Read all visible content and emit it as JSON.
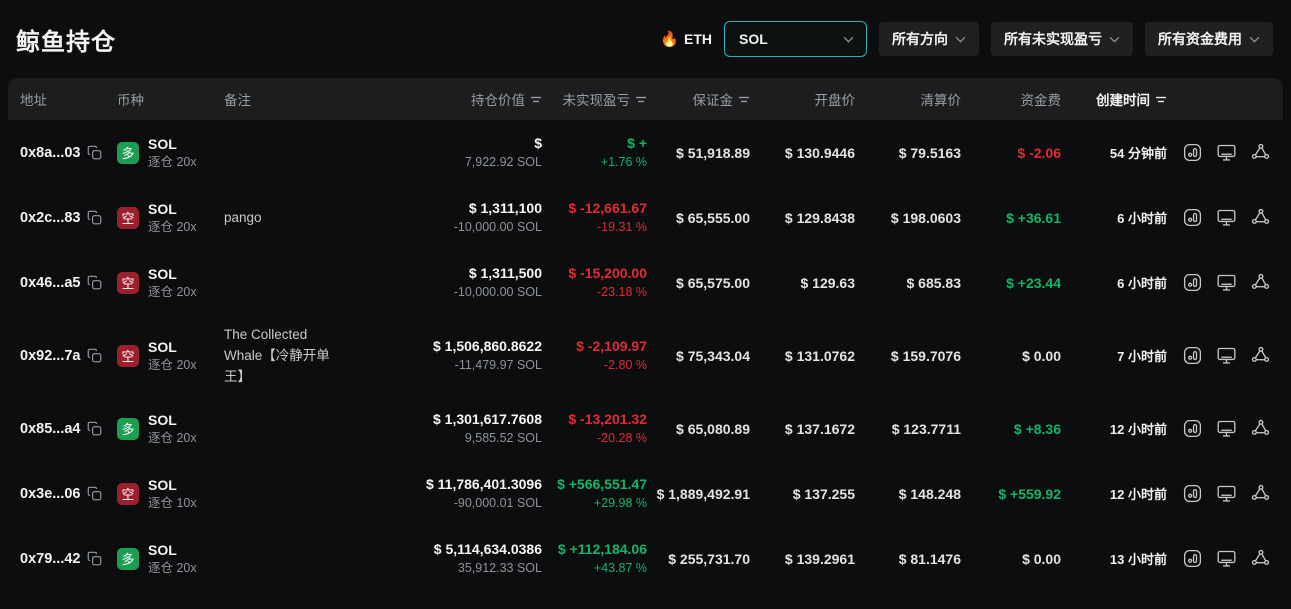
{
  "page": {
    "title": "鲸鱼持仓"
  },
  "filters": {
    "fire_icon": "🔥",
    "hot_coin_label": "ETH",
    "coin_select": {
      "value": "SOL"
    },
    "direction_dropdown": "所有方向",
    "pnl_dropdown": "所有未实现盈亏",
    "funding_dropdown": "所有资金费用"
  },
  "colors": {
    "green": "#0fb768",
    "red": "#e12b36",
    "accent_teal": "#2fb2b5",
    "badge_green": "#1e9e53",
    "badge_red": "#9c1f2d"
  },
  "table": {
    "columns": [
      {
        "label": "地址"
      },
      {
        "label": "币种"
      },
      {
        "label": "备注"
      },
      {
        "label": "持仓价值"
      },
      {
        "label": "未实现盈亏"
      },
      {
        "label": "保证金"
      },
      {
        "label": "开盘价"
      },
      {
        "label": "清算价"
      },
      {
        "label": "资金费"
      },
      {
        "label": "创建时间"
      }
    ],
    "rows": [
      {
        "address": "0x8a...03",
        "side": "多",
        "side_dir": "long",
        "coin": "SOL",
        "mode": "逐仓 20x",
        "note": "",
        "value_usd": "$",
        "value_amt": "7,922.92 SOL",
        "pnl_usd": "$ +",
        "pnl_pct": "+1.76 %",
        "pnl_dir": "up",
        "margin": "$ 51,918.89",
        "open_price": "$ 130.9446",
        "liq_price": "$ 79.5163",
        "funding": "$ -2.06",
        "funding_dir": "down",
        "created": "54 分钟前"
      },
      {
        "address": "0x2c...83",
        "side": "空",
        "side_dir": "short",
        "coin": "SOL",
        "mode": "逐仓 20x",
        "note": "pango",
        "value_usd": "$ 1,311,100",
        "value_amt": "-10,000.00 SOL",
        "pnl_usd": "$ -12,661.67",
        "pnl_pct": "-19.31 %",
        "pnl_dir": "down",
        "margin": "$ 65,555.00",
        "open_price": "$ 129.8438",
        "liq_price": "$ 198.0603",
        "funding": "$ +36.61",
        "funding_dir": "up",
        "created": "6 小时前"
      },
      {
        "address": "0x46...a5",
        "side": "空",
        "side_dir": "short",
        "coin": "SOL",
        "mode": "逐仓 20x",
        "note": "",
        "value_usd": "$ 1,311,500",
        "value_amt": "-10,000.00 SOL",
        "pnl_usd": "$ -15,200.00",
        "pnl_pct": "-23.18 %",
        "pnl_dir": "down",
        "margin": "$ 65,575.00",
        "open_price": "$ 129.63",
        "liq_price": "$ 685.83",
        "funding": "$ +23.44",
        "funding_dir": "up",
        "created": "6 小时前"
      },
      {
        "address": "0x92...7a",
        "side": "空",
        "side_dir": "short",
        "coin": "SOL",
        "mode": "逐仓 20x",
        "note": "The Collected Whale【冷静开单王】",
        "value_usd": "$ 1,506,860.8622",
        "value_amt": "-11,479.97 SOL",
        "pnl_usd": "$ -2,109.97",
        "pnl_pct": "-2.80 %",
        "pnl_dir": "down",
        "margin": "$ 75,343.04",
        "open_price": "$ 131.0762",
        "liq_price": "$ 159.7076",
        "funding": "$ 0.00",
        "funding_dir": "flat",
        "created": "7 小时前"
      },
      {
        "address": "0x85...a4",
        "side": "多",
        "side_dir": "long",
        "coin": "SOL",
        "mode": "逐仓 20x",
        "note": "",
        "value_usd": "$ 1,301,617.7608",
        "value_amt": "9,585.52 SOL",
        "pnl_usd": "$ -13,201.32",
        "pnl_pct": "-20.28 %",
        "pnl_dir": "down",
        "margin": "$ 65,080.89",
        "open_price": "$ 137.1672",
        "liq_price": "$ 123.7711",
        "funding": "$ +8.36",
        "funding_dir": "up",
        "created": "12 小时前"
      },
      {
        "address": "0x3e...06",
        "side": "空",
        "side_dir": "short",
        "coin": "SOL",
        "mode": "逐仓 10x",
        "note": "",
        "value_usd": "$ 11,786,401.3096",
        "value_amt": "-90,000.01 SOL",
        "pnl_usd": "$ +566,551.47",
        "pnl_pct": "+29.98 %",
        "pnl_dir": "up",
        "margin": "$ 1,889,492.91",
        "open_price": "$ 137.255",
        "liq_price": "$ 148.248",
        "funding": "$ +559.92",
        "funding_dir": "up",
        "created": "12 小时前"
      },
      {
        "address": "0x79...42",
        "side": "多",
        "side_dir": "long",
        "coin": "SOL",
        "mode": "逐仓 20x",
        "note": "",
        "value_usd": "$ 5,114,634.0386",
        "value_amt": "35,912.33 SOL",
        "pnl_usd": "$ +112,184.06",
        "pnl_pct": "+43.87 %",
        "pnl_dir": "up",
        "margin": "$ 255,731.70",
        "open_price": "$ 139.2961",
        "liq_price": "$ 81.1476",
        "funding": "$ 0.00",
        "funding_dir": "flat",
        "created": "13 小时前"
      }
    ]
  }
}
